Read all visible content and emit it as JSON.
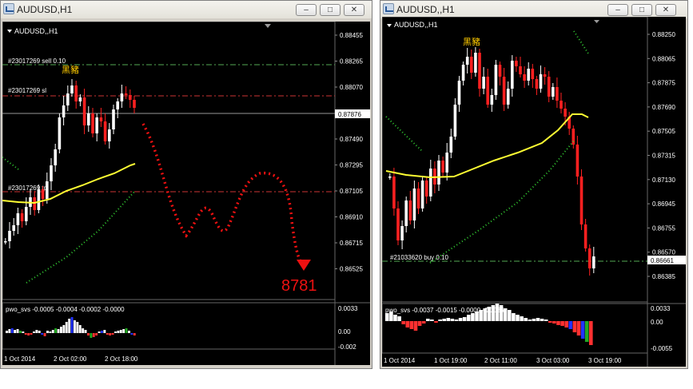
{
  "windows": [
    {
      "title": "AUDUSD,H1",
      "chart_label": "AUDUSD,,H1",
      "price_labels": [
        "0.88455",
        "0.88265",
        "0.88070",
        "0.87876",
        "0.87685",
        "0.87490",
        "0.87295",
        "0.87105",
        "0.86910",
        "0.86715",
        "0.86525"
      ],
      "current_price": "0.87876",
      "order_label_sell": "#23017269 sell 0.10",
      "order_label_sl": "#23017269 sl",
      "order_label_tp": "#23017269 tp",
      "annotation": "黑豬",
      "forecast": "8781",
      "indicator": {
        "label": "pwo_svs -0.0005 -0.0004 -0.0002 -0.0000",
        "levels": [
          "0.0033",
          "0.00",
          "-0.002"
        ]
      },
      "time_labels": [
        "1 Oct 2014",
        "2 Oct 02:00",
        "2 Oct 18:00"
      ]
    },
    {
      "title": "AUDUSD,,H1",
      "chart_label": "AUDUSD,,H1",
      "price_labels": [
        "0.88250",
        "0.88065",
        "0.87875",
        "0.87690",
        "0.87505",
        "0.87315",
        "0.87130",
        "0.86945",
        "0.86755",
        "0.86661",
        "0.86570",
        "0.86385"
      ],
      "current_price": "0.86661",
      "order_label": "#21033620 buy 0.10",
      "annotation": "黑豬",
      "indicator": {
        "label": "pwo_svs -0.0037 -0.0015 -0.0000 -0.0036",
        "levels": [
          "0.0033",
          "0.00",
          "-0.0055"
        ]
      },
      "time_labels": [
        "1 Oct 2014",
        "1 Oct 19:00",
        "2 Oct 11:00",
        "3 Oct 03:00",
        "3 Oct 19:00"
      ]
    }
  ],
  "colors": {
    "bull": "#ffffff",
    "bear": "#ff2020",
    "ma": "#ffff33",
    "sar": "#33cc33",
    "order_line": "#55aa55",
    "sl_line": "#cc3333",
    "forecast": "#ee1111",
    "annotation": "#ffcc00"
  }
}
